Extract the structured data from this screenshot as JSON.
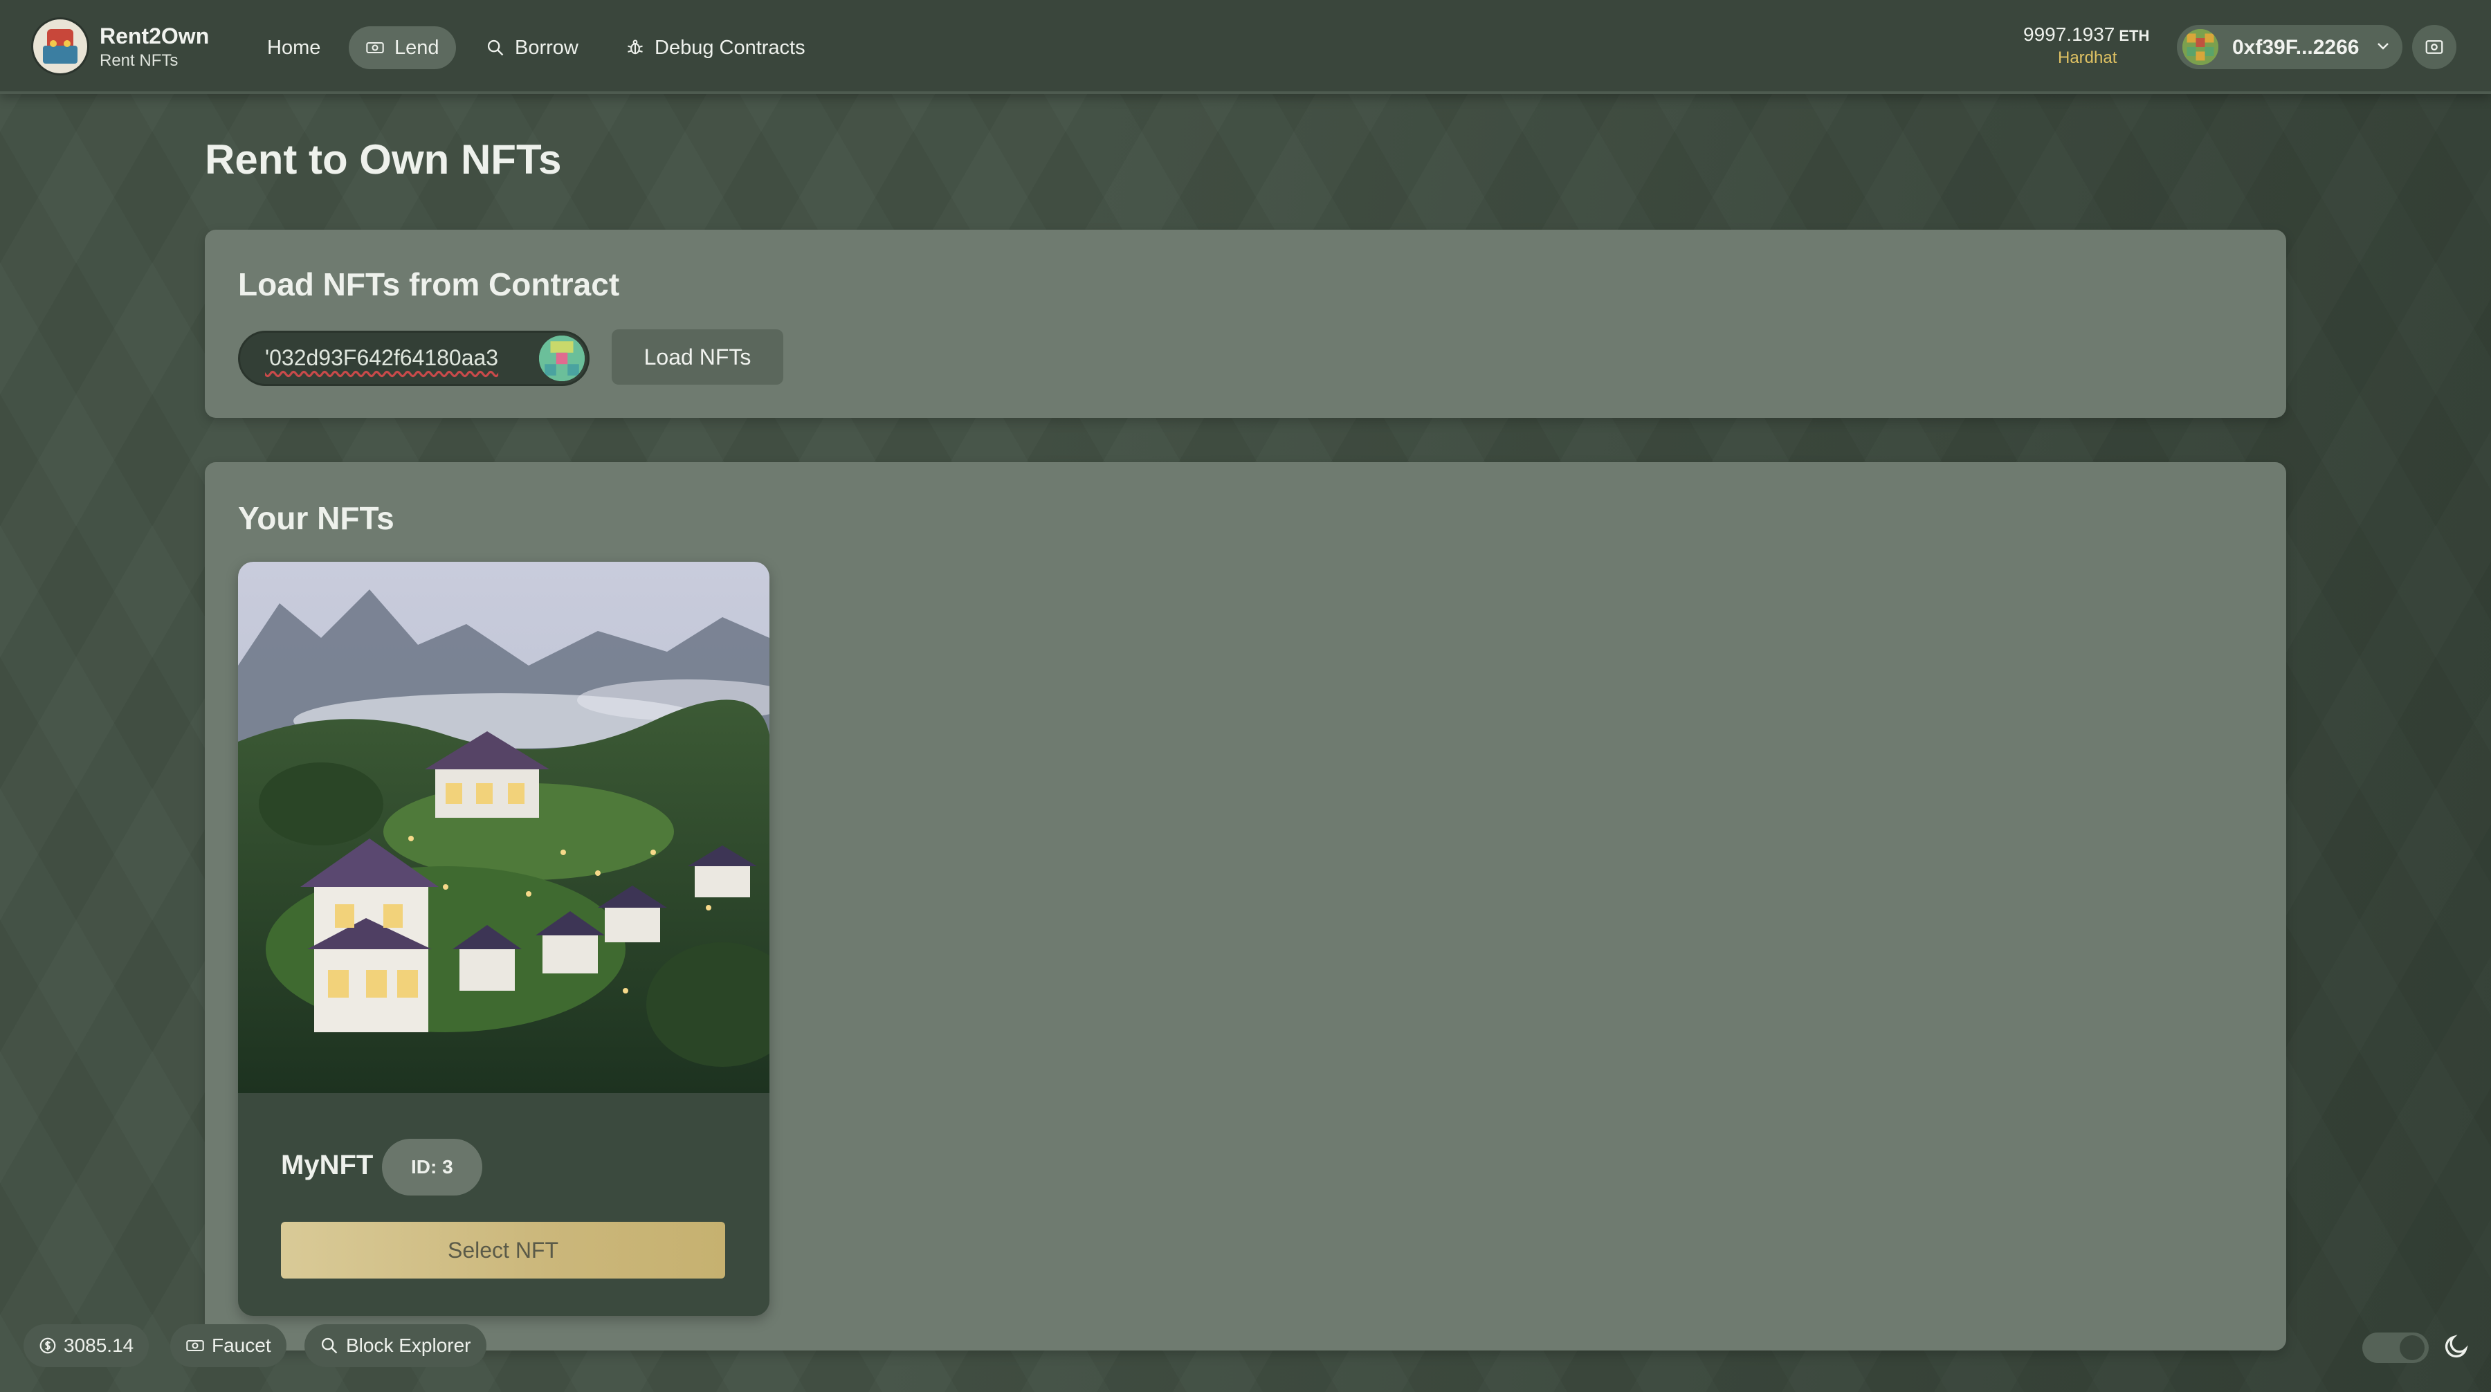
{
  "brand": {
    "name": "Rent2Own",
    "subtitle": "Rent NFTs"
  },
  "nav": [
    {
      "label": "Home",
      "icon": "none",
      "active": false
    },
    {
      "label": "Lend",
      "icon": "banknote-icon",
      "active": true
    },
    {
      "label": "Borrow",
      "icon": "search-icon",
      "active": false
    },
    {
      "label": "Debug Contracts",
      "icon": "bug-icon",
      "active": false
    }
  ],
  "account": {
    "balance": "9997.1937",
    "currency": "ETH",
    "network": "Hardhat",
    "address": "0xf39F...2266"
  },
  "page": {
    "title": "Rent to Own NFTs"
  },
  "load_section": {
    "title": "Load NFTs from Contract",
    "contract_address_value": "'032d93F642f64180aa3",
    "button_label": "Load NFTs"
  },
  "nfts_section": {
    "title": "Your NFTs",
    "items": [
      {
        "name": "MyNFT",
        "badge": "ID: 3",
        "button_label": "Select NFT",
        "image": "villa-in-jungle-mountains"
      }
    ]
  },
  "footer": {
    "price": "3085.14",
    "faucet_label": "Faucet",
    "explorer_label": "Block Explorer"
  },
  "colors": {
    "background": "#445246",
    "card": "#6f7b70",
    "accent_gold": "#d9ca97",
    "network": "#e0c263"
  }
}
